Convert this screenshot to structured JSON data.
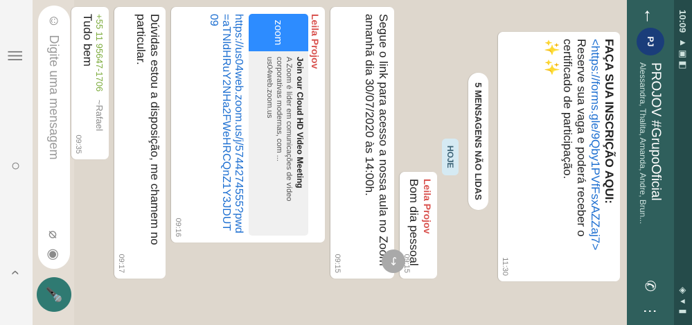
{
  "status": {
    "time": "10:09",
    "icons": "▲ ▣ ◧",
    "right": "◈ ▾ ▮"
  },
  "header": {
    "title": "PROJOV #GrupoOficial",
    "subtitle": "Alessandra, Thalita, Amanda, Andre, Brun...",
    "avatar_text": "PJ"
  },
  "messages": {
    "m1": {
      "heading": "FAÇA SUA INSCRIÇÃO AQUI:",
      "link": "<https://forms.gle/9Qby1PVfFsxAZZaj7>",
      "text": "Reserve sua vaga e poderá receber o certificado de participação.",
      "time": "11:30"
    },
    "unread": "5 MENSAGENS NÃO LIDAS",
    "today": "HOJE",
    "m2": {
      "sender": "Leila Projov",
      "text": "Bom dia pessoal",
      "time": "09:15"
    },
    "m3": {
      "text": "Segue o link para acesso a nossa aula no Zoom amanhã dia 30/07/2020 às 14:00h.",
      "time": "09:15"
    },
    "m4": {
      "sender": "Leila Projov",
      "preview_title": "Join our Cloud HD Video Meeting",
      "preview_desc": "A Zoom é líder em comunicações de vídeo corporativas modernas, com ...",
      "preview_domain": "us04web.zoom.us",
      "thumb": "zoom",
      "link": "https://us04web.zoom.us/j/5744274555?pwd=aTNldHRuY2NHa2FWeHRCQnZ1Y3JDUT09",
      "time": "09:16"
    },
    "m5": {
      "text": "Dúvidas estou a disposição, me chamem no particular.",
      "time": "09:17"
    },
    "m6": {
      "sender": "+55 11 95647-1706",
      "alias": "~Rafael",
      "text": "Tudo bem",
      "time": "09:35"
    }
  },
  "input": {
    "placeholder": "Digite uma mensagem"
  },
  "colors": {
    "appbar": "#2f5f5c",
    "bubble": "#ffffff",
    "link": "#1d6fd1",
    "sender": "#d9534f",
    "fab": "#2f7a72"
  }
}
